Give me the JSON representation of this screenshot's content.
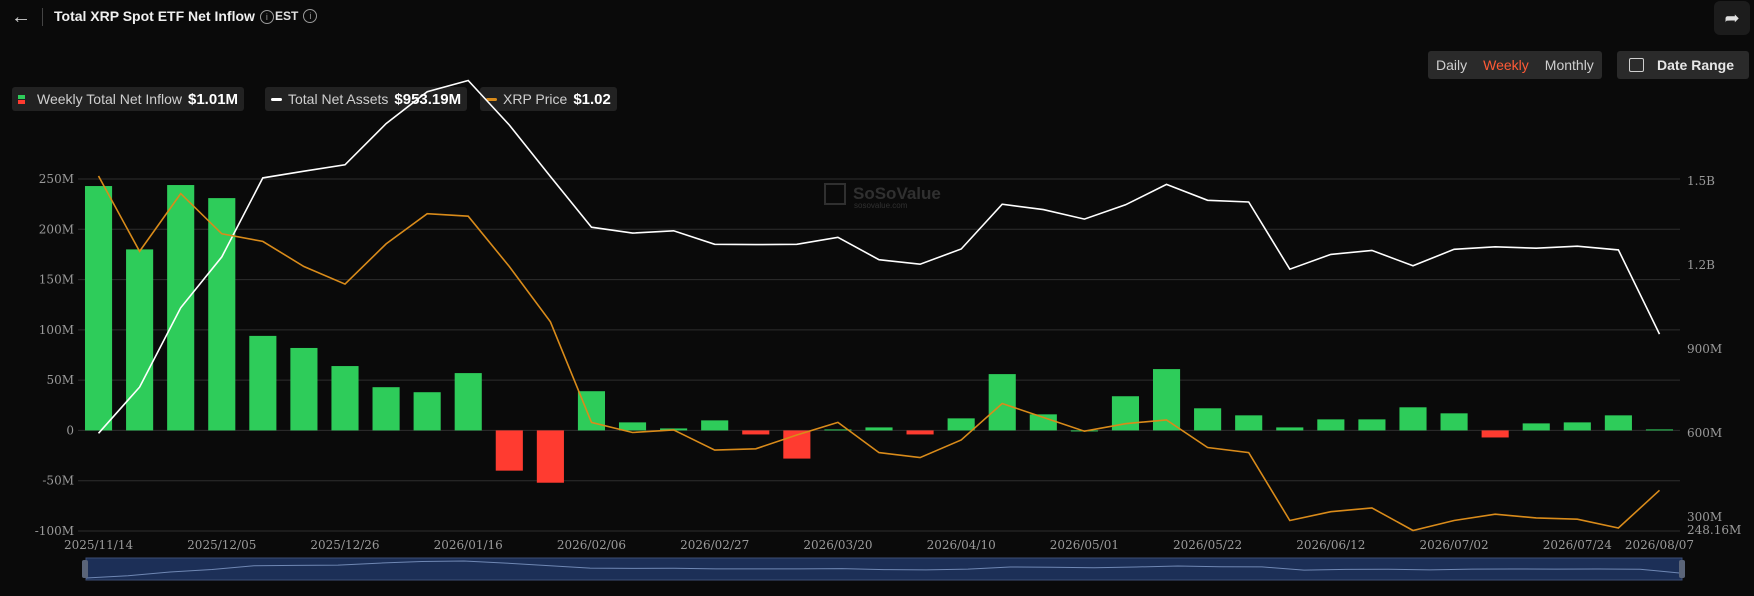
{
  "header": {
    "title": "Total XRP Spot ETF Net Inflow",
    "info_glyph": "i",
    "timezone": "EST"
  },
  "period_tabs": [
    "Daily",
    "Weekly",
    "Monthly"
  ],
  "active_period": "Weekly",
  "date_range_label": "Date Range",
  "legend": [
    {
      "label": "Weekly Total Net Inflow",
      "value": "$1.01M"
    },
    {
      "label": "Total Net Assets",
      "value": "$953.19M"
    },
    {
      "label": "XRP Price",
      "value": "$1.02"
    }
  ],
  "watermark": {
    "brand": "SoSoValue",
    "site": "sosovalue.com"
  },
  "colors": {
    "positive": "#2ecc5a",
    "negative": "#ff3b30",
    "assets_line": "#ffffff",
    "price_line": "#d98b1a",
    "grid": "#2e2e2e",
    "text": "#9a9a9a"
  },
  "chart_data": {
    "type": "bar",
    "categories": [
      "2025/11/14",
      "2025/11/21",
      "2025/11/28",
      "2025/12/05",
      "2025/12/12",
      "2025/12/19",
      "2025/12/26",
      "2026/01/02",
      "2026/01/09",
      "2026/01/16",
      "2026/01/23",
      "2026/01/30",
      "2026/02/06",
      "2026/02/13",
      "2026/02/20",
      "2026/02/27",
      "2026/03/06",
      "2026/03/13",
      "2026/03/20",
      "2026/03/27",
      "2026/04/03",
      "2026/04/10",
      "2026/04/17",
      "2026/04/24",
      "2026/05/01",
      "2026/05/08",
      "2026/05/15",
      "2026/05/22",
      "2026/05/29",
      "2026/06/05",
      "2026/06/12",
      "2026/06/19",
      "2026/06/26",
      "2026/07/02",
      "2026/07/10",
      "2026/07/17",
      "2026/07/24",
      "2026/07/31",
      "2026/08/07"
    ],
    "x_tick_labels": [
      "2025/11/14",
      "2025/12/05",
      "2025/12/26",
      "2026/01/16",
      "2026/02/06",
      "2026/02/27",
      "2026/03/20",
      "2026/04/10",
      "2026/05/01",
      "2026/05/22",
      "2026/06/12",
      "2026/07/02",
      "2026/07/24",
      "2026/08/07"
    ],
    "series": [
      {
        "name": "Weekly Total Net Inflow",
        "axis": "left",
        "type": "bar",
        "values": [
          243,
          180,
          244,
          231,
          94,
          82,
          64,
          43,
          38,
          57,
          -40,
          -52,
          39,
          8,
          2,
          10,
          -4,
          -28,
          1,
          3,
          -4,
          12,
          56,
          16,
          0,
          34,
          61,
          22,
          15,
          3,
          11,
          11,
          23,
          17,
          -7,
          7,
          8,
          15,
          1.01
        ]
      },
      {
        "name": "Total Net Assets",
        "axis": "right",
        "type": "line",
        "values": [
          599,
          764,
          1047,
          1229,
          1511,
          1535,
          1558,
          1705,
          1819,
          1859,
          1700,
          1516,
          1335,
          1314,
          1322,
          1274,
          1273,
          1274,
          1299,
          1219,
          1203,
          1257,
          1417,
          1398,
          1364,
          1415,
          1488,
          1431,
          1425,
          1185,
          1238,
          1252,
          1197,
          1256,
          1265,
          1260,
          1267,
          1254,
          953.19
        ]
      },
      {
        "name": "XRP Price",
        "axis": "right_price",
        "type": "line",
        "values": [
          2.27,
          1.97,
          2.2,
          2.04,
          2.01,
          1.91,
          1.84,
          2.0,
          2.12,
          2.11,
          1.91,
          1.69,
          1.29,
          1.25,
          1.26,
          1.18,
          1.185,
          1.24,
          1.29,
          1.17,
          1.15,
          1.22,
          1.365,
          1.31,
          1.255,
          1.285,
          1.3,
          1.19,
          1.17,
          0.9,
          0.935,
          0.95,
          0.86,
          0.9,
          0.925,
          0.91,
          0.905,
          0.87,
          1.02
        ]
      }
    ],
    "y_left": {
      "ticks": [
        "250M",
        "200M",
        "150M",
        "100M",
        "50M",
        "0",
        "-50M",
        "-100M"
      ],
      "ylim": [
        -100,
        250
      ],
      "unit": "M"
    },
    "y_right": {
      "ticks": [
        "1.5B",
        "1.2B",
        "900M",
        "600M",
        "300M"
      ],
      "min_label": "248.16M"
    },
    "grid": true,
    "legend_position": "top-left"
  }
}
